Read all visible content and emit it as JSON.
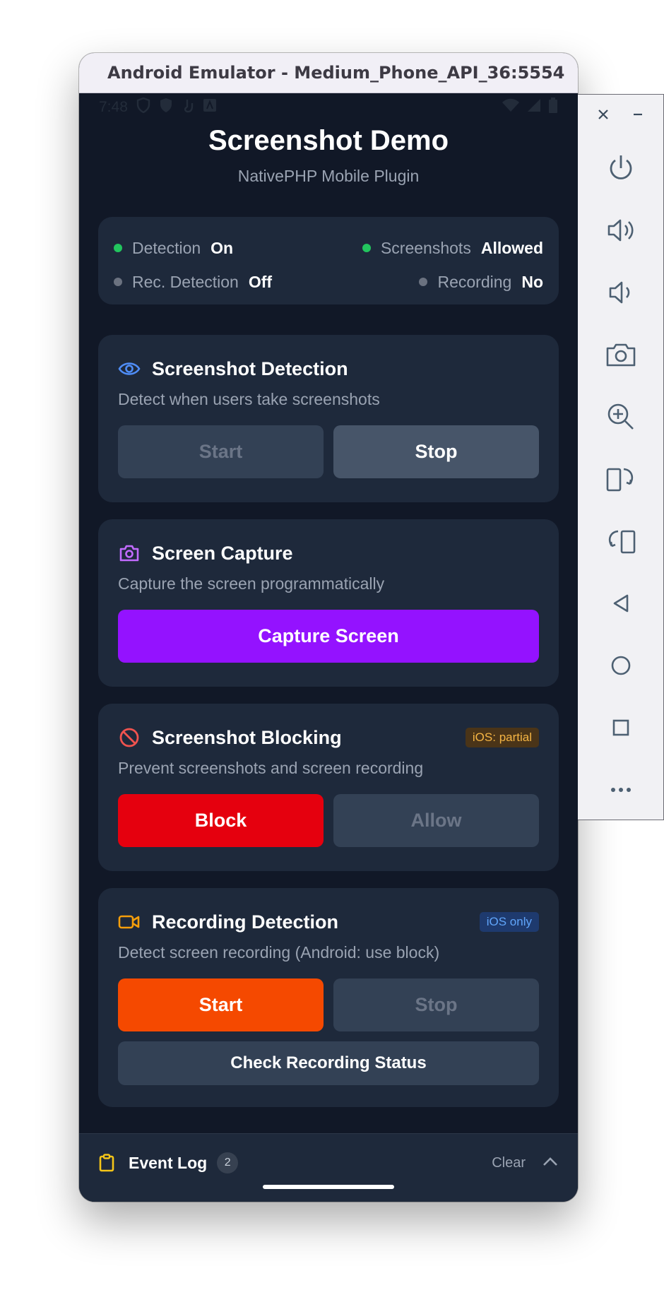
{
  "window": {
    "title": "Android Emulator - Medium_Phone_API_36:5554"
  },
  "statusbar": {
    "time": "7:48"
  },
  "app": {
    "title": "Screenshot Demo",
    "subtitle": "NativePHP Mobile Plugin"
  },
  "status": {
    "detection": {
      "label": "Detection",
      "value": "On",
      "color": "#22c55e"
    },
    "screenshots": {
      "label": "Screenshots",
      "value": "Allowed",
      "color": "#22c55e"
    },
    "rec_detection": {
      "label": "Rec. Detection",
      "value": "Off",
      "color": "#6b7280"
    },
    "recording": {
      "label": "Recording",
      "value": "No",
      "color": "#6b7280"
    }
  },
  "cards": {
    "detection": {
      "icon": "eye-icon",
      "title": "Screenshot Detection",
      "desc": "Detect when users take screenshots",
      "start": "Start",
      "stop": "Stop"
    },
    "capture": {
      "icon": "camera-icon",
      "title": "Screen Capture",
      "desc": "Capture the screen programmatically",
      "button": "Capture Screen"
    },
    "blocking": {
      "icon": "ban-icon",
      "title": "Screenshot Blocking",
      "badge": "iOS: partial",
      "desc": "Prevent screenshots and screen recording",
      "block": "Block",
      "allow": "Allow"
    },
    "recording": {
      "icon": "video-icon",
      "title": "Recording Detection",
      "badge": "iOS only",
      "desc": "Detect screen recording (Android: use block)",
      "start": "Start",
      "stop": "Stop",
      "check": "Check Recording Status"
    }
  },
  "event_log": {
    "icon": "clipboard-icon",
    "title": "Event Log",
    "count": "2",
    "clear": "Clear"
  },
  "colors": {
    "purple": "#9412ff",
    "red": "#e5000e",
    "orange": "#f54900",
    "background": "#111827",
    "card": "#1e293b"
  }
}
